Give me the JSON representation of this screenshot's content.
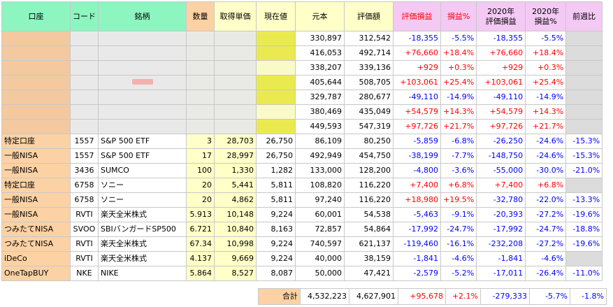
{
  "headers": {
    "account": "口座",
    "code": "コード",
    "name": "銘柄",
    "qty": "数量",
    "cost": "取得単価",
    "price": "現在値",
    "principal": "元本",
    "valuation": "評価額",
    "pl": "評価損益",
    "pl_pct": "損益%",
    "pl2020_line1": "2020年",
    "pl2020_line2": "評価損益",
    "pct2020_line1": "2020年",
    "pct2020_line2": "損益%",
    "prev": "前週比"
  },
  "masked_rows": [
    {
      "principal": "330,897",
      "valuation": "312,542",
      "pl": "-18,355",
      "pl_pct": "-5.5%",
      "pl2020": "-18,355",
      "pct2020": "-5.5%"
    },
    {
      "principal": "416,053",
      "valuation": "492,714",
      "pl": "+76,660",
      "pl_pct": "+18.4%",
      "pl2020": "+76,660",
      "pct2020": "+18.4%"
    },
    {
      "principal": "338,207",
      "valuation": "339,136",
      "pl": "+929",
      "pl_pct": "+0.3%",
      "pl2020": "+929",
      "pct2020": "+0.3%"
    },
    {
      "principal": "405,644",
      "valuation": "508,705",
      "pl": "+103,061",
      "pl_pct": "+25.4%",
      "pl2020": "+103,061",
      "pct2020": "+25.4%"
    },
    {
      "principal": "329,787",
      "valuation": "280,677",
      "pl": "-49,110",
      "pl_pct": "-14.9%",
      "pl2020": "-49,110",
      "pct2020": "-14.9%"
    },
    {
      "principal": "380,469",
      "valuation": "435,049",
      "pl": "+54,579",
      "pl_pct": "+14.3%",
      "pl2020": "+54,579",
      "pct2020": "+14.3%"
    },
    {
      "principal": "449,593",
      "valuation": "547,319",
      "pl": "+97,726",
      "pl_pct": "+21.7%",
      "pl2020": "+97,726",
      "pct2020": "+21.7%"
    }
  ],
  "rows": [
    {
      "account": "特定口座",
      "code": "1557",
      "name": "S&P 500 ETF",
      "qty": "3",
      "cost": "28,703",
      "price": "26,750",
      "principal": "86,109",
      "valuation": "80,250",
      "pl": "-5,859",
      "pl_pct": "-6.8%",
      "pl2020": "-26,250",
      "pct2020": "-24.6%",
      "prev": "-15.3%"
    },
    {
      "account": "一般NISA",
      "code": "1557",
      "name": "S&P 500 ETF",
      "qty": "17",
      "cost": "28,997",
      "price": "26,750",
      "principal": "492,949",
      "valuation": "454,750",
      "pl": "-38,199",
      "pl_pct": "-7.7%",
      "pl2020": "-148,750",
      "pct2020": "-24.6%",
      "prev": "-15.3%"
    },
    {
      "account": "一般NISA",
      "code": "3436",
      "name": "SUMCO",
      "qty": "100",
      "cost": "1,330",
      "price": "1,282",
      "principal": "133,000",
      "valuation": "128,200",
      "pl": "-4,800",
      "pl_pct": "-3.6%",
      "pl2020": "-55,000",
      "pct2020": "-30.0%",
      "prev": "-21.0%"
    },
    {
      "account": "特定口座",
      "code": "6758",
      "name": "ソニー",
      "qty": "20",
      "cost": "5,441",
      "price": "5,811",
      "principal": "108,820",
      "valuation": "116,220",
      "pl": "+7,400",
      "pl_pct": "+6.8%",
      "pl2020": "+7,400",
      "pct2020": "+6.8%",
      "prev": ""
    },
    {
      "account": "一般NISA",
      "code": "6758",
      "name": "ソニー",
      "qty": "20",
      "cost": "4,862",
      "price": "5,811",
      "principal": "97,240",
      "valuation": "116,220",
      "pl": "+18,980",
      "pl_pct": "+19.5%",
      "pl2020": "-32,780",
      "pct2020": "-22.0%",
      "prev": "-13.3%"
    },
    {
      "account": "一般NISA",
      "code": "RVTI",
      "name": "楽天全米株式",
      "qty": "5.913",
      "cost": "10,148",
      "price": "9,224",
      "principal": "60,001",
      "valuation": "54,538",
      "pl": "-5,463",
      "pl_pct": "-9.1%",
      "pl2020": "-20,393",
      "pct2020": "-27.2%",
      "prev": "-19.6%"
    },
    {
      "account": "つみたてNISA",
      "code": "SVOO",
      "name": "SBIバンガードSP500",
      "qty": "6.721",
      "cost": "10,840",
      "price": "8,163",
      "principal": "72,857",
      "valuation": "54,864",
      "pl": "-17,992",
      "pl_pct": "-24.7%",
      "pl2020": "-17,992",
      "pct2020": "-24.7%",
      "prev": "-18.8%"
    },
    {
      "account": "つみたてNISA",
      "code": "RVTI",
      "name": "楽天全米株式",
      "qty": "67.34",
      "cost": "10,998",
      "price": "9,224",
      "principal": "740,597",
      "valuation": "621,137",
      "pl": "-119,460",
      "pl_pct": "-16.1%",
      "pl2020": "-232,208",
      "pct2020": "-27.2%",
      "prev": "-19.6%"
    },
    {
      "account": "iDeCo",
      "code": "RVTI",
      "name": "楽天全米株式",
      "qty": "4.137",
      "cost": "9,669",
      "price": "9,224",
      "principal": "40,000",
      "valuation": "38,159",
      "pl": "-1,841",
      "pl_pct": "-4.6%",
      "pl2020": "-1,841",
      "pct2020": "-4.6%",
      "prev": ""
    },
    {
      "account": "OneTapBUY",
      "code": "NKE",
      "name": "NIKE",
      "qty": "5.864",
      "cost": "8,527",
      "price": "8,087",
      "principal": "50,000",
      "valuation": "47,421",
      "pl": "-2,579",
      "pl_pct": "-5.2%",
      "pl2020": "-17,011",
      "pct2020": "-26.4%",
      "prev": "-11.0%"
    }
  ],
  "total": {
    "label": "合計",
    "principal": "4,532,223",
    "valuation": "4,627,901",
    "pl": "+95,678",
    "pl_pct": "+2.1%",
    "pl2020": "-279,333",
    "pct2020": "-5.7%",
    "prev": "-1.8%"
  },
  "colors": {
    "header_green": "#8df5c0",
    "header_pink": "#f4c9f4",
    "account_orange": "#fcd2a4",
    "input_yellow": "#ffffc8",
    "positive": "#ff0000",
    "negative": "#0000ff"
  }
}
